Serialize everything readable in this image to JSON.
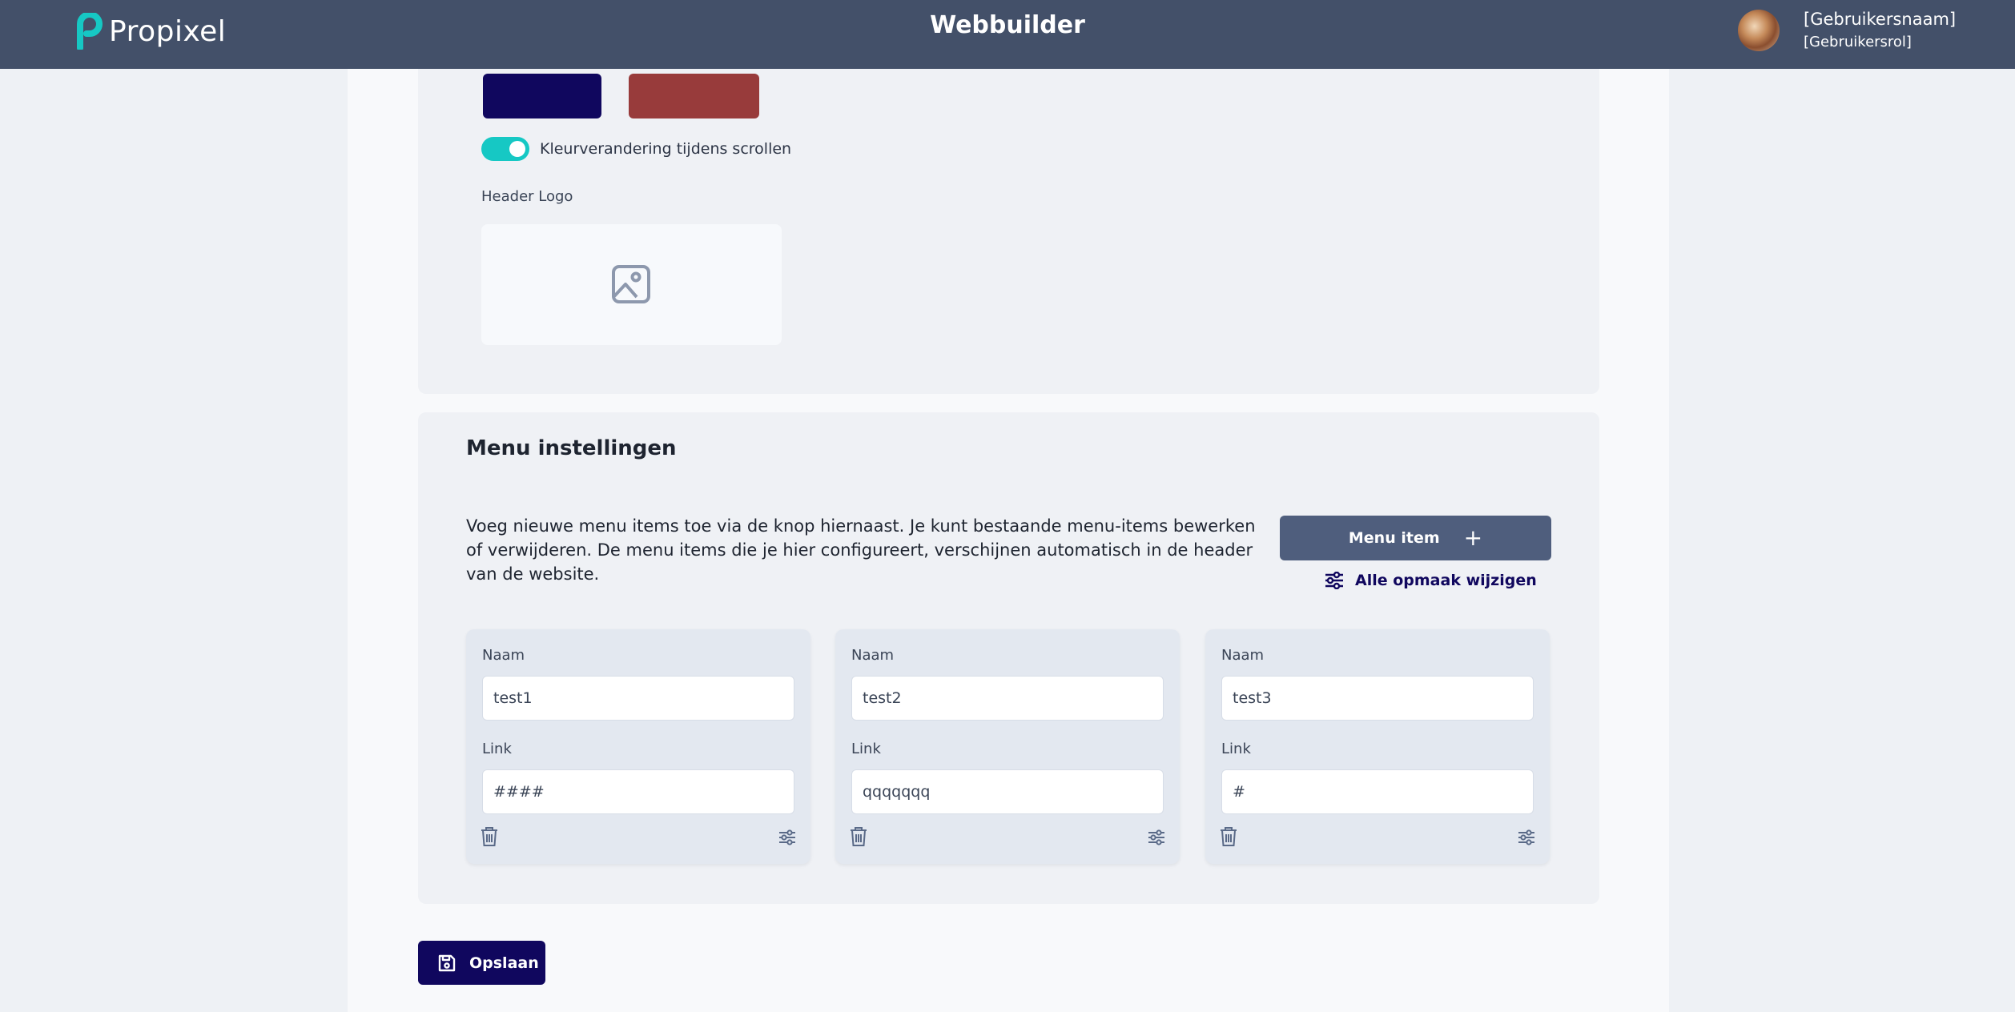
{
  "header": {
    "brand": "Propixel",
    "title": "Webbuilder",
    "user_name": "[Gebruikersnaam]",
    "user_role": "[Gebruikersrol]"
  },
  "colors": {
    "topbar": "#435069",
    "primary": "#10075e",
    "secondary": "#983b3b",
    "accent": "#16c8c4",
    "button_secondary": "#4f5e7d"
  },
  "header_settings": {
    "toggle_label": "Kleurverandering tijdens scrollen",
    "toggle_on": true,
    "logo_label": "Header Logo",
    "logo_placeholder_icon": "image-icon"
  },
  "menu": {
    "title": "Menu instellingen",
    "description": "Voeg nieuwe menu items toe via de knop hiernaast. Je kunt bestaande menu-items bewerken of verwijderen. De menu items die je hier configureert, verschijnen automatisch in de header van de website.",
    "add_button": "Menu item",
    "edit_all_link": "Alle opmaak wijzigen",
    "items": [
      {
        "name_label": "Naam",
        "name": "test1",
        "link_label": "Link",
        "link": "####"
      },
      {
        "name_label": "Naam",
        "name": "test2",
        "link_label": "Link",
        "link": "qqqqqqq"
      },
      {
        "name_label": "Naam",
        "name": "test3",
        "link_label": "Link",
        "link": "#"
      }
    ]
  },
  "save_button": "Opslaan"
}
